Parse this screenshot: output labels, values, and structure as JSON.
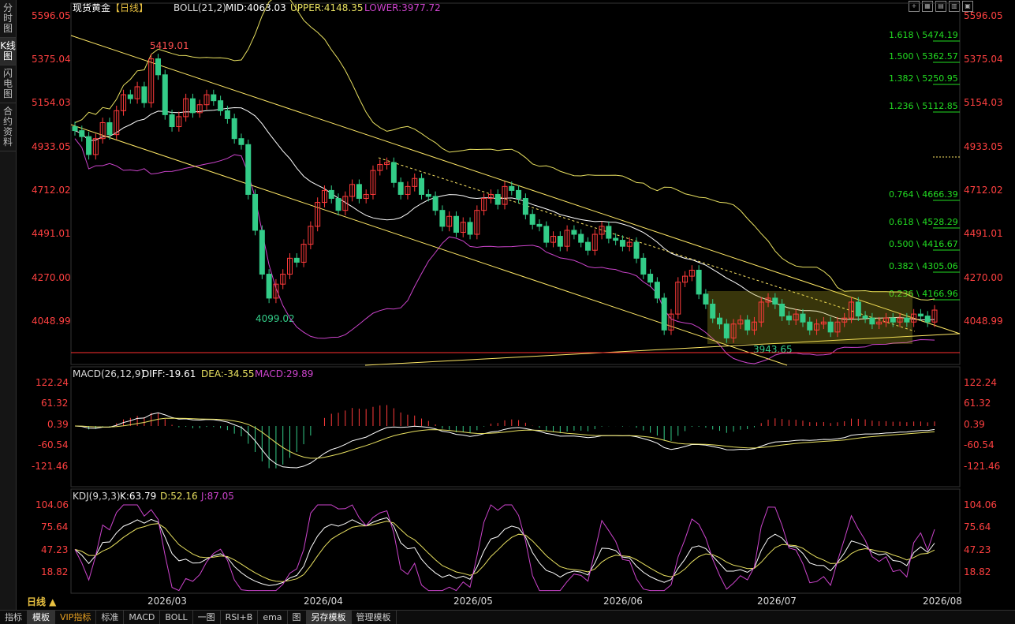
{
  "sidebar": {
    "tabs": [
      {
        "label": "分时图"
      },
      {
        "label": "K线图"
      },
      {
        "label": "闪电图"
      },
      {
        "label": "合约资料"
      }
    ]
  },
  "period_label": "日线 ▲",
  "bottom_tabs": [
    {
      "label": "指标"
    },
    {
      "label": "模板"
    },
    {
      "label": "VIP指标"
    },
    {
      "label": "标准"
    },
    {
      "label": "MACD"
    },
    {
      "label": "BOLL"
    },
    {
      "label": "一图"
    },
    {
      "label": "RSI+B"
    },
    {
      "label": "ema"
    },
    {
      "label": "图"
    },
    {
      "label": "另存模板"
    },
    {
      "label": "管理模板"
    }
  ],
  "colors": {
    "up": "#ff3b3b",
    "down": "#33cc88",
    "mid": "#ffffff",
    "upper": "#e8e060",
    "lower": "#cc44cc",
    "channel": "#ffe866",
    "fib": "#22dd22",
    "grid": "#222"
  },
  "main": {
    "header": {
      "title": "现货黄金",
      "period": "【日线】",
      "indicator": "BOLL(21,2)",
      "mid": "MID:4063.03",
      "upper": "UPPER:4148.35",
      "lower": "LOWER:3977.72"
    },
    "y_ticks": [
      "5596.05",
      "5375.04",
      "5154.03",
      "4933.05",
      "4712.02",
      "4491.01",
      "4270.00",
      "4048.99"
    ],
    "annotations": {
      "high": "5419.01",
      "low": "4099.02",
      "low2": "3943.65"
    },
    "fib_levels": [
      {
        "label": "1.618",
        "value": "5474.19"
      },
      {
        "label": "1.500",
        "value": "5362.57"
      },
      {
        "label": "1.382",
        "value": "5250.95"
      },
      {
        "label": "1.236",
        "value": "5112.85"
      },
      {
        "label": "0.764",
        "value": "4666.39"
      },
      {
        "label": "0.618",
        "value": "4528.29"
      },
      {
        "label": "0.500",
        "value": "4416.67"
      },
      {
        "label": "0.382",
        "value": "4305.06"
      },
      {
        "label": "0.236",
        "value": "4166.96"
      }
    ]
  },
  "macd": {
    "header": {
      "name": "MACD(26,12,9)",
      "diff": "DIFF:-19.61",
      "dea": "DEA:-34.55",
      "macd": "MACD:29.89"
    },
    "y_ticks": [
      "122.24",
      "61.32",
      "0.39",
      "-60.54",
      "-121.46"
    ]
  },
  "kdj": {
    "header": {
      "name": "KDJ(9,3,3)",
      "k": "K:63.79",
      "d": "D:52.16",
      "j": "J:87.05"
    },
    "y_ticks": [
      "104.06",
      "75.64",
      "47.23",
      "18.82"
    ]
  },
  "x_ticks": [
    "2026/03",
    "2026/04",
    "2026/05",
    "2026/06",
    "2026/07",
    "2026/08"
  ],
  "chart_data": {
    "type": "candlestick",
    "title": "现货黄金 日线",
    "ylim": [
      3900,
      5650
    ],
    "x": [
      "2026/03",
      "2026/04",
      "2026/05",
      "2026/06",
      "2026/07",
      "2026/08"
    ],
    "closes": [
      5020,
      4990,
      4900,
      4980,
      5060,
      5000,
      5120,
      5200,
      5180,
      5240,
      5160,
      5380,
      5300,
      5100,
      5040,
      5090,
      5180,
      5110,
      5150,
      5200,
      5170,
      5120,
      5080,
      4980,
      4950,
      4700,
      4520,
      4300,
      4180,
      4250,
      4300,
      4380,
      4360,
      4450,
      4540,
      4660,
      4720,
      4680,
      4620,
      4690,
      4750,
      4680,
      4700,
      4820,
      4850,
      4860,
      4760,
      4700,
      4740,
      4780,
      4700,
      4690,
      4620,
      4540,
      4590,
      4510,
      4560,
      4500,
      4620,
      4680,
      4700,
      4650,
      4740,
      4720,
      4680,
      4600,
      4550,
      4540,
      4460,
      4490,
      4440,
      4520,
      4500,
      4460,
      4420,
      4500,
      4540,
      4480,
      4470,
      4440,
      4460,
      4380,
      4300,
      4260,
      4180,
      4020,
      4100,
      4260,
      4290,
      4320,
      4200,
      4150,
      4080,
      4050,
      3980,
      4050,
      4070,
      4020,
      4060,
      4160,
      4180,
      4150,
      4090,
      4070,
      4100,
      4060,
      4020,
      4050,
      4060,
      4010,
      4060,
      4080,
      4160,
      4090,
      4080,
      4050,
      4060,
      4080,
      4060,
      4080,
      4060,
      4100,
      4090,
      4060,
      4120
    ]
  }
}
